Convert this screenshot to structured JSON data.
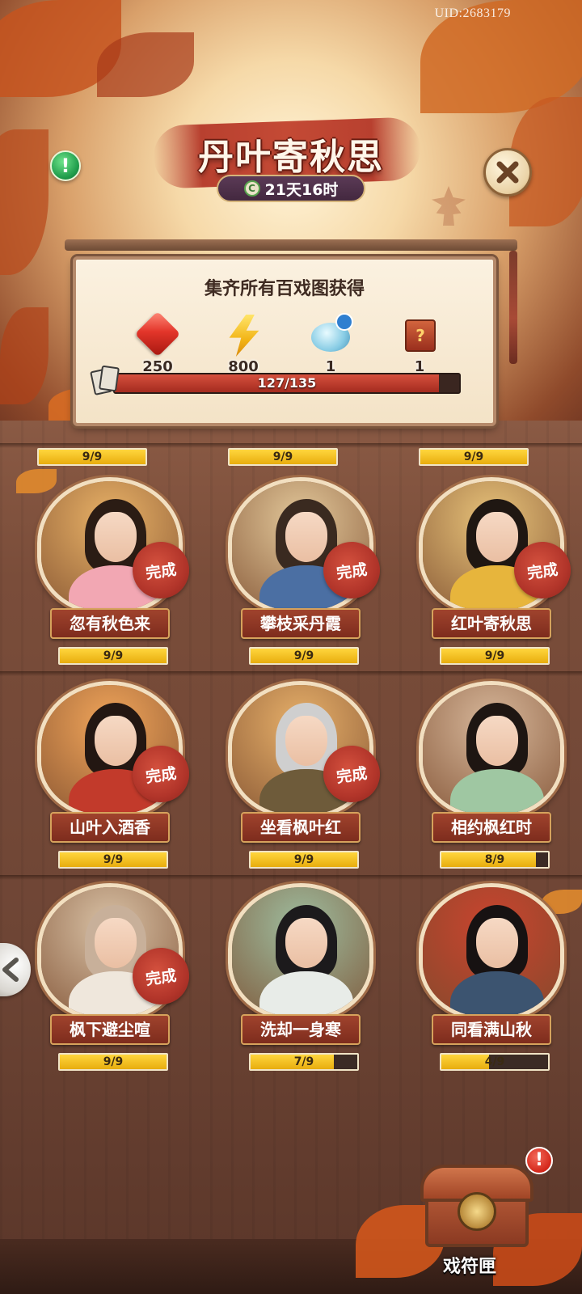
{
  "uid": "UID:2683179",
  "header": {
    "title": "丹叶寄秋思",
    "timer": "21天16时",
    "timer_icon": "clock-coin-icon"
  },
  "reward_panel": {
    "title": "集齐所有百戏图获得",
    "rewards": [
      {
        "icon": "ruby-gem-icon",
        "qty": "250"
      },
      {
        "icon": "lightning-bolt-icon",
        "qty": "800"
      },
      {
        "icon": "cloud-gourd-search-icon",
        "qty": "1"
      },
      {
        "icon": "mystery-chest-icon",
        "qty": "1"
      }
    ],
    "progress": {
      "text": "127/135",
      "current": 127,
      "total": 135
    }
  },
  "top_row_bars": [
    "9/9",
    "9/9",
    "9/9"
  ],
  "cells": [
    {
      "name": "忽有秋色来",
      "progress": "9/9",
      "fraction": 1.0,
      "completed": true,
      "stamp": "完成"
    },
    {
      "name": "攀枝采丹霞",
      "progress": "9/9",
      "fraction": 1.0,
      "completed": true,
      "stamp": "完成"
    },
    {
      "name": "红叶寄秋思",
      "progress": "9/9",
      "fraction": 1.0,
      "completed": true,
      "stamp": "完成"
    },
    {
      "name": "山叶入酒香",
      "progress": "9/9",
      "fraction": 1.0,
      "completed": true,
      "stamp": "完成"
    },
    {
      "name": "坐看枫叶红",
      "progress": "9/9",
      "fraction": 1.0,
      "completed": true,
      "stamp": "完成"
    },
    {
      "name": "相约枫红时",
      "progress": "8/9",
      "fraction": 0.889,
      "completed": false,
      "stamp": ""
    },
    {
      "name": "枫下避尘喧",
      "progress": "9/9",
      "fraction": 1.0,
      "completed": true,
      "stamp": "完成"
    },
    {
      "name": "洗却一身寒",
      "progress": "7/9",
      "fraction": 0.778,
      "completed": false,
      "stamp": ""
    },
    {
      "name": "同看满山秋",
      "progress": "4/9",
      "fraction": 0.444,
      "completed": false,
      "stamp": ""
    }
  ],
  "chest_button": {
    "label": "戏符匣",
    "badge": "!"
  },
  "info_badge": "!",
  "colors": {
    "accent_red": "#b8402f",
    "progress_yellow": "#ffd63d",
    "info_green": "#1f9c4b"
  }
}
